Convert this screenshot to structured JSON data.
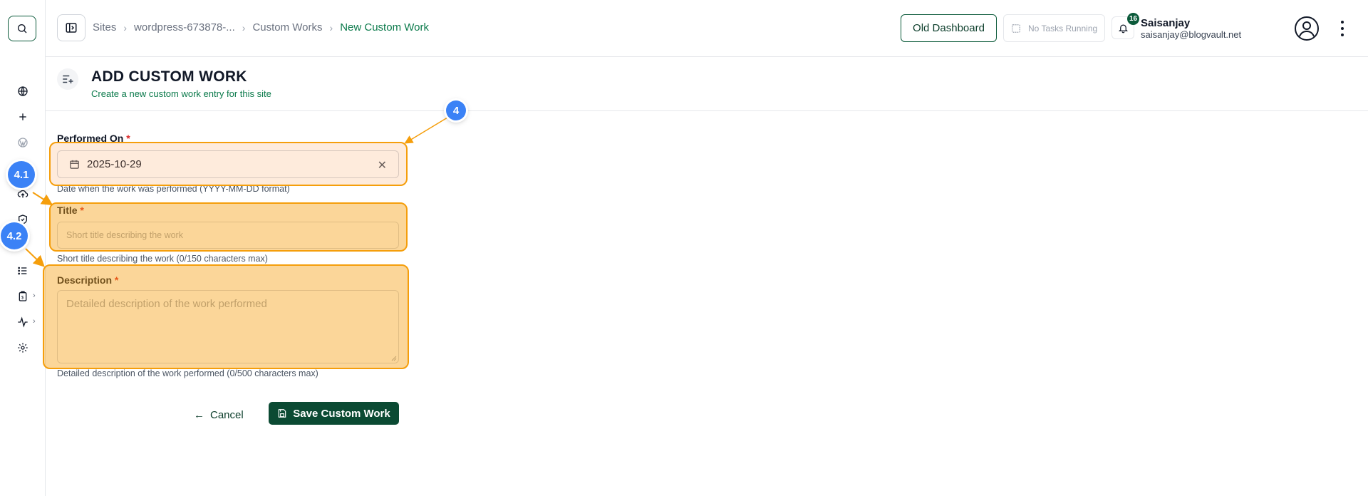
{
  "header": {
    "breadcrumb": [
      "Sites",
      "wordpress-673878-...",
      "Custom Works",
      "New Custom Work"
    ],
    "old_dashboard_label": "Old Dashboard",
    "tasks_label": "No Tasks Running",
    "notification_count": "16",
    "user_name": "Saisanjay",
    "user_email": "saisanjay@blogvault.net"
  },
  "page": {
    "title": "ADD CUSTOM WORK",
    "subtitle": "Create a new custom work entry for this site"
  },
  "form": {
    "performed_on": {
      "label": "Performed On",
      "required_mark": "*",
      "value": "2025-10-29",
      "help": "Date when the work was performed (YYYY-MM-DD format)"
    },
    "title": {
      "label": "Title",
      "required_mark": "*",
      "placeholder": "Short title describing the work",
      "help": "Short title describing the work (0/150 characters max)"
    },
    "description": {
      "label": "Description",
      "required_mark": "*",
      "placeholder": "Detailed description of the work performed",
      "help": "Detailed description of the work performed (0/500 characters max)"
    },
    "cancel_label": "Cancel",
    "save_label": "Save Custom Work"
  },
  "annotations": {
    "step_main": "4",
    "step_a": "4.1",
    "step_b": "4.2",
    "bubble_color": "#3b82f6",
    "highlight_color": "#f59e0b"
  },
  "sidebar": {
    "icons": [
      "globe-icon",
      "plus-icon",
      "wordpress-icon",
      "cloud-upload-icon",
      "shield-icon",
      "list-icon",
      "report-icon",
      "activity-icon",
      "settings-icon"
    ]
  },
  "colors": {
    "brand": "#0b4a33",
    "accent_text": "#0b7a4b",
    "required": "#dc2626"
  }
}
